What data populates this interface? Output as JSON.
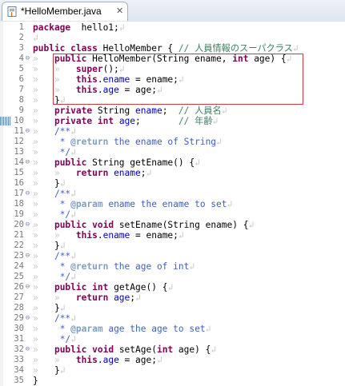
{
  "tab": {
    "title": "*HelloMember.java",
    "close_symbol": "✕",
    "icon": "java-file-icon"
  },
  "colors": {
    "keyword": "#7f0055",
    "comment": "#3f7f5f",
    "javadoc": "#3f5fbf",
    "javadoc_tag": "#7f9fbf",
    "field": "#0000c0",
    "highlight_border": "#c0404a"
  },
  "editor": {
    "selected_line": 10,
    "highlight_box_lines": [
      4,
      8
    ],
    "lines": [
      {
        "n": "1",
        "fold": "",
        "segs": [
          [
            "kw",
            "package"
          ],
          [
            "",
            "  hello1;"
          ],
          [
            "ws",
            "↲"
          ]
        ]
      },
      {
        "n": "2",
        "fold": "",
        "segs": [
          [
            "ws",
            "↲"
          ]
        ]
      },
      {
        "n": "3",
        "fold": "",
        "segs": [
          [
            "kw",
            "public"
          ],
          [
            "",
            " "
          ],
          [
            "kw",
            "class"
          ],
          [
            "",
            " HelloMember { "
          ],
          [
            "cm",
            "// 人員情報のスーパクラス"
          ],
          [
            "ws",
            "↲"
          ]
        ]
      },
      {
        "n": "4",
        "fold": "⊖",
        "segs": [
          [
            "ws",
            "»   "
          ],
          [
            "kw",
            "public"
          ],
          [
            "",
            " HelloMember(String ename, "
          ],
          [
            "kw",
            "int"
          ],
          [
            "",
            " age) {"
          ],
          [
            "ws",
            "↲"
          ]
        ]
      },
      {
        "n": "5",
        "fold": "",
        "segs": [
          [
            "ws",
            "»   »   "
          ],
          [
            "kw",
            "super"
          ],
          [
            "",
            "();"
          ],
          [
            "ws",
            "↲"
          ]
        ]
      },
      {
        "n": "6",
        "fold": "",
        "segs": [
          [
            "ws",
            "»   »   "
          ],
          [
            "kw",
            "this"
          ],
          [
            "",
            "."
          ],
          [
            "fld",
            "ename"
          ],
          [
            "",
            " = ename;"
          ],
          [
            "ws",
            "↲"
          ]
        ]
      },
      {
        "n": "7",
        "fold": "",
        "segs": [
          [
            "ws",
            "»   »   "
          ],
          [
            "kw",
            "this"
          ],
          [
            "",
            "."
          ],
          [
            "fld",
            "age"
          ],
          [
            "",
            " = age;"
          ],
          [
            "ws",
            "↲"
          ]
        ]
      },
      {
        "n": "8",
        "fold": "",
        "segs": [
          [
            "ws",
            "»   "
          ],
          [
            "",
            "}"
          ],
          [
            "ws",
            "↲"
          ]
        ]
      },
      {
        "n": "9",
        "fold": "",
        "segs": [
          [
            "ws",
            "»   "
          ],
          [
            "kw",
            "private"
          ],
          [
            "",
            " String "
          ],
          [
            "fld",
            "ename"
          ],
          [
            "",
            ";  "
          ],
          [
            "cm",
            "// 人員名"
          ],
          [
            "ws",
            "↲"
          ]
        ]
      },
      {
        "n": "10",
        "fold": "",
        "segs": [
          [
            "ws",
            "»   "
          ],
          [
            "kw",
            "private"
          ],
          [
            "",
            " "
          ],
          [
            "kw",
            "int"
          ],
          [
            "",
            " "
          ],
          [
            "fld",
            "age"
          ],
          [
            "",
            ";       "
          ],
          [
            "cm",
            "// 年齢"
          ],
          [
            "ws",
            "↲"
          ]
        ]
      },
      {
        "n": "11",
        "fold": "⊖",
        "segs": [
          [
            "ws",
            "»   "
          ],
          [
            "jd",
            "/**"
          ],
          [
            "ws",
            "↲"
          ]
        ]
      },
      {
        "n": "12",
        "fold": "",
        "segs": [
          [
            "ws",
            "»   "
          ],
          [
            "jd",
            " * "
          ],
          [
            "tag",
            "@return"
          ],
          [
            "jd",
            " the ename of String"
          ],
          [
            "ws",
            "↲"
          ]
        ]
      },
      {
        "n": "13",
        "fold": "",
        "segs": [
          [
            "ws",
            "»   "
          ],
          [
            "jd",
            " */"
          ],
          [
            "ws",
            "↲"
          ]
        ]
      },
      {
        "n": "14",
        "fold": "⊖",
        "segs": [
          [
            "ws",
            "»   "
          ],
          [
            "kw",
            "public"
          ],
          [
            "",
            " String getEname() {"
          ],
          [
            "ws",
            "↲"
          ]
        ]
      },
      {
        "n": "15",
        "fold": "",
        "segs": [
          [
            "ws",
            "»   »   "
          ],
          [
            "kw",
            "return"
          ],
          [
            "",
            " "
          ],
          [
            "fld",
            "ename"
          ],
          [
            "",
            ";"
          ],
          [
            "ws",
            "↲"
          ]
        ]
      },
      {
        "n": "16",
        "fold": "",
        "segs": [
          [
            "ws",
            "»   "
          ],
          [
            "",
            "}"
          ],
          [
            "ws",
            "↲"
          ]
        ]
      },
      {
        "n": "17",
        "fold": "⊖",
        "segs": [
          [
            "ws",
            "»   "
          ],
          [
            "jd",
            "/**"
          ],
          [
            "ws",
            "↲"
          ]
        ]
      },
      {
        "n": "18",
        "fold": "",
        "segs": [
          [
            "ws",
            "»   "
          ],
          [
            "jd",
            " * "
          ],
          [
            "tag",
            "@param"
          ],
          [
            "jd",
            " ename the ename to set"
          ],
          [
            "ws",
            "↲"
          ]
        ]
      },
      {
        "n": "19",
        "fold": "",
        "segs": [
          [
            "ws",
            "»   "
          ],
          [
            "jd",
            " */"
          ],
          [
            "ws",
            "↲"
          ]
        ]
      },
      {
        "n": "20",
        "fold": "⊖",
        "segs": [
          [
            "ws",
            "»   "
          ],
          [
            "kw",
            "public"
          ],
          [
            "",
            " "
          ],
          [
            "kw",
            "void"
          ],
          [
            "",
            " setEname(String ename) {"
          ],
          [
            "ws",
            "↲"
          ]
        ]
      },
      {
        "n": "21",
        "fold": "",
        "segs": [
          [
            "ws",
            "»   »   "
          ],
          [
            "kw",
            "this"
          ],
          [
            "",
            "."
          ],
          [
            "fld",
            "ename"
          ],
          [
            "",
            " = ename;"
          ],
          [
            "ws",
            "↲"
          ]
        ]
      },
      {
        "n": "22",
        "fold": "",
        "segs": [
          [
            "ws",
            "»   "
          ],
          [
            "",
            "}"
          ],
          [
            "ws",
            "↲"
          ]
        ]
      },
      {
        "n": "23",
        "fold": "⊖",
        "segs": [
          [
            "ws",
            "»   "
          ],
          [
            "jd",
            "/**"
          ],
          [
            "ws",
            "↲"
          ]
        ]
      },
      {
        "n": "24",
        "fold": "",
        "segs": [
          [
            "ws",
            "»   "
          ],
          [
            "jd",
            " * "
          ],
          [
            "tag",
            "@return"
          ],
          [
            "jd",
            " the age of int"
          ],
          [
            "ws",
            "↲"
          ]
        ]
      },
      {
        "n": "25",
        "fold": "",
        "segs": [
          [
            "ws",
            "»   "
          ],
          [
            "jd",
            " */"
          ],
          [
            "ws",
            "↲"
          ]
        ]
      },
      {
        "n": "26",
        "fold": "⊖",
        "segs": [
          [
            "ws",
            "»   "
          ],
          [
            "kw",
            "public"
          ],
          [
            "",
            " "
          ],
          [
            "kw",
            "int"
          ],
          [
            "",
            " getAge() {"
          ],
          [
            "ws",
            "↲"
          ]
        ]
      },
      {
        "n": "27",
        "fold": "",
        "segs": [
          [
            "ws",
            "»   »   "
          ],
          [
            "kw",
            "return"
          ],
          [
            "",
            " "
          ],
          [
            "fld",
            "age"
          ],
          [
            "",
            ";"
          ],
          [
            "ws",
            "↲"
          ]
        ]
      },
      {
        "n": "28",
        "fold": "",
        "segs": [
          [
            "ws",
            "»   "
          ],
          [
            "",
            "}"
          ],
          [
            "ws",
            "↲"
          ]
        ]
      },
      {
        "n": "29",
        "fold": "⊖",
        "segs": [
          [
            "ws",
            "»   "
          ],
          [
            "jd",
            "/**"
          ],
          [
            "ws",
            "↲"
          ]
        ]
      },
      {
        "n": "30",
        "fold": "",
        "segs": [
          [
            "ws",
            "»   "
          ],
          [
            "jd",
            " * "
          ],
          [
            "tag",
            "@param"
          ],
          [
            "jd",
            " age the age to set"
          ],
          [
            "ws",
            "↲"
          ]
        ]
      },
      {
        "n": "31",
        "fold": "",
        "segs": [
          [
            "ws",
            "»   "
          ],
          [
            "jd",
            " */"
          ],
          [
            "ws",
            "↲"
          ]
        ]
      },
      {
        "n": "32",
        "fold": "⊖",
        "segs": [
          [
            "ws",
            "»   "
          ],
          [
            "kw",
            "public"
          ],
          [
            "",
            " "
          ],
          [
            "kw",
            "void"
          ],
          [
            "",
            " setAge("
          ],
          [
            "kw",
            "int"
          ],
          [
            "",
            " age) {"
          ],
          [
            "ws",
            "↲"
          ]
        ]
      },
      {
        "n": "33",
        "fold": "",
        "segs": [
          [
            "ws",
            "»   »   "
          ],
          [
            "kw",
            "this"
          ],
          [
            "",
            "."
          ],
          [
            "fld",
            "age"
          ],
          [
            "",
            " = age;"
          ],
          [
            "ws",
            "↲"
          ]
        ]
      },
      {
        "n": "34",
        "fold": "",
        "segs": [
          [
            "ws",
            "»   "
          ],
          [
            "",
            "}"
          ],
          [
            "ws",
            "↲"
          ]
        ]
      },
      {
        "n": "35",
        "fold": "",
        "segs": [
          [
            "",
            "}"
          ]
        ]
      }
    ]
  }
}
